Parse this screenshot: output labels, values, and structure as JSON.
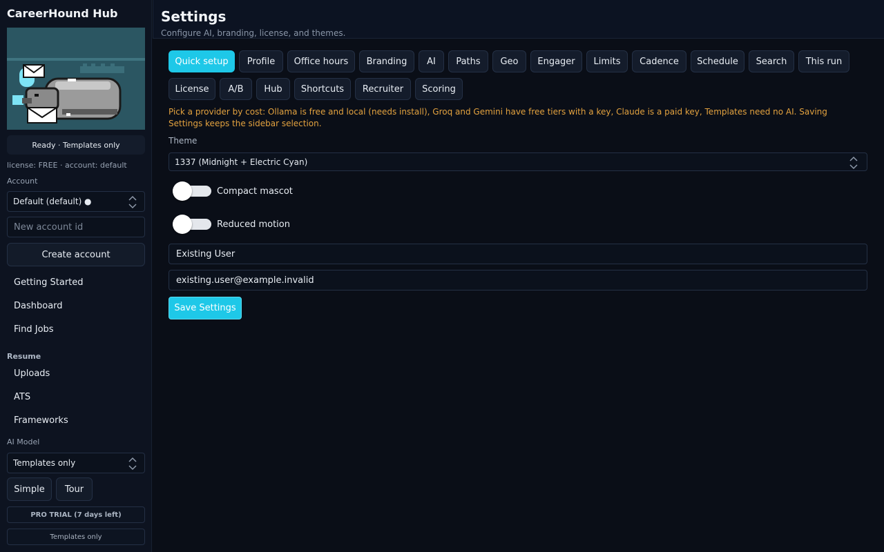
{
  "app": {
    "title": "CareerHound Hub"
  },
  "sidebar": {
    "status": "Ready · Templates only",
    "license_line": "license: FREE · account: default",
    "account_label": "Account",
    "account_select": "Default (default) ●",
    "new_account_placeholder": "New account id",
    "create_account": "Create account",
    "nav_top": [
      {
        "label": "Getting Started"
      },
      {
        "label": "Dashboard"
      },
      {
        "label": "Find Jobs"
      }
    ],
    "resume_section": "Resume",
    "nav_resume": [
      {
        "label": "Uploads"
      },
      {
        "label": "ATS"
      },
      {
        "label": "Frameworks"
      }
    ],
    "ai_model_label": "AI Model",
    "ai_model_select": "Templates only",
    "simple_button": "Simple",
    "tour_button": "Tour",
    "trial_badge": "PRO TRIAL (7 days left)",
    "mode_badge": "Templates only"
  },
  "header": {
    "title": "Settings",
    "subtitle": "Configure AI, branding, license, and themes."
  },
  "tabs": [
    {
      "label": "Quick setup",
      "active": true
    },
    {
      "label": "Profile"
    },
    {
      "label": "Office hours"
    },
    {
      "label": "Branding"
    },
    {
      "label": "AI"
    },
    {
      "label": "Paths"
    },
    {
      "label": "Geo"
    },
    {
      "label": "Engager"
    },
    {
      "label": "Limits"
    },
    {
      "label": "Cadence"
    },
    {
      "label": "Schedule"
    },
    {
      "label": "Search"
    },
    {
      "label": "This run"
    },
    {
      "label": "License"
    },
    {
      "label": "A/B"
    },
    {
      "label": "Hub"
    },
    {
      "label": "Shortcuts"
    },
    {
      "label": "Recruiter"
    },
    {
      "label": "Scoring"
    }
  ],
  "main": {
    "hint": "Pick a provider by cost: Ollama is free and local (needs install), Groq and Gemini have free tiers with a key, Claude is a paid key, Templates need no AI. Saving Settings keeps the sidebar selection.",
    "theme_label": "Theme",
    "theme_value": "1337 (Midnight + Electric Cyan)",
    "compact_mascot_label": "Compact mascot",
    "compact_mascot_on": false,
    "reduced_motion_label": "Reduced motion",
    "reduced_motion_on": false,
    "name_value": "Existing User",
    "email_value": "existing.user@example.invalid",
    "save_button": "Save Settings"
  },
  "colors": {
    "accent": "#1ec8e8",
    "hint": "#e3a23f",
    "background": "#0a0e17"
  }
}
